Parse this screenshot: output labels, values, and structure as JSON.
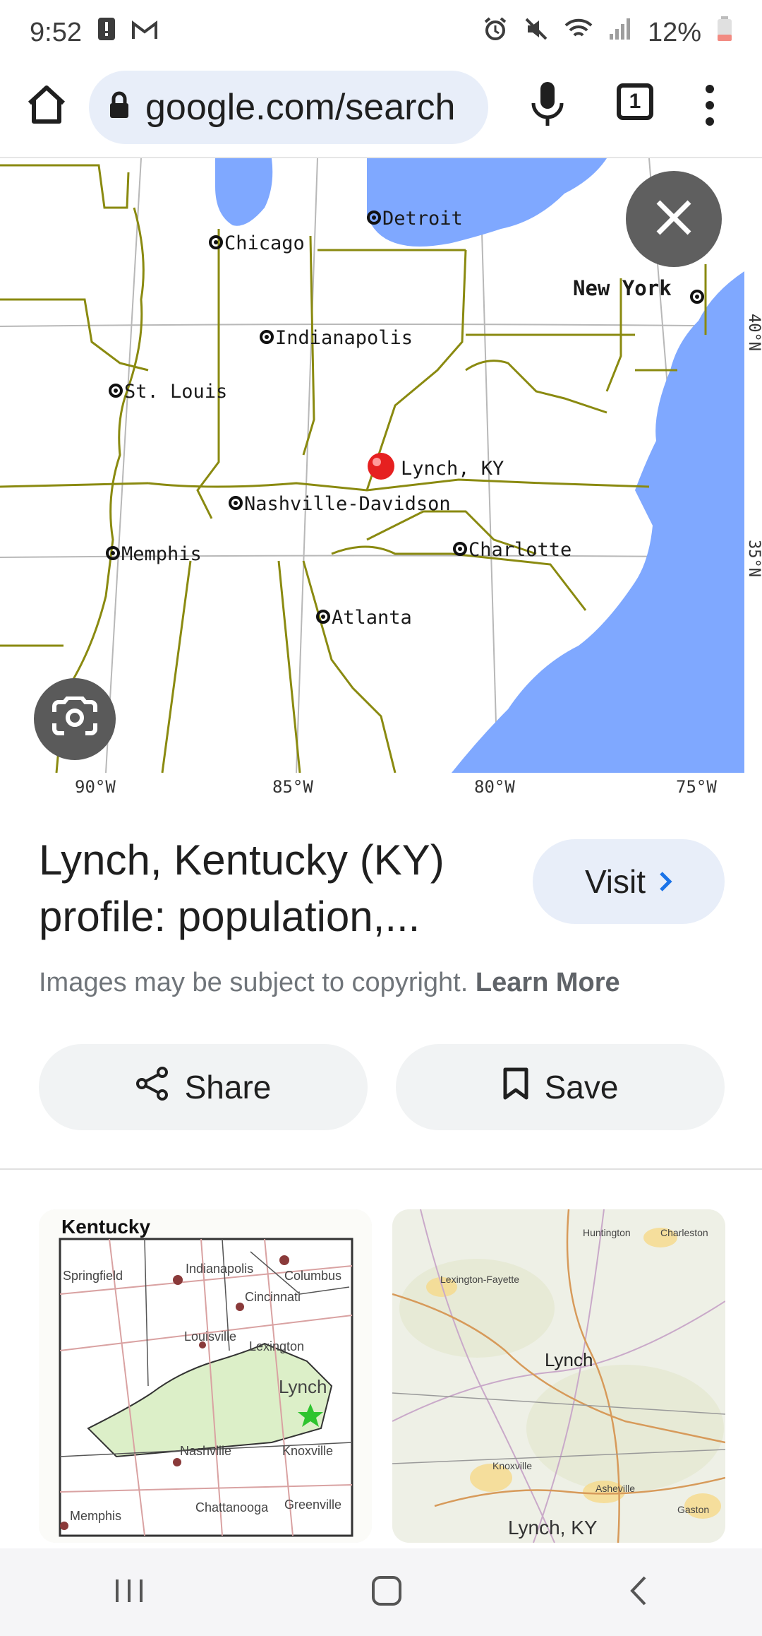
{
  "status": {
    "time": "9:52",
    "battery": "12%"
  },
  "browser": {
    "url": "google.com/search",
    "tab_count": "1"
  },
  "map": {
    "cities": [
      "Detroit",
      "Chicago",
      "New York",
      "Indianapolis",
      "St. Louis",
      "Lynch, KY",
      "Nashville-Davidson",
      "Memphis",
      "Charlotte",
      "Atlanta"
    ],
    "lon_labels": [
      "90°W",
      "85°W",
      "80°W",
      "75°W"
    ],
    "lat_labels": [
      "40°N",
      "35°N"
    ]
  },
  "result": {
    "title": "Lynch, Kentucky (KY) profile: population,...",
    "visit_label": "Visit",
    "copyright_text": "Images may be subject to copyright.",
    "learn_more": "Learn More",
    "share_label": "Share",
    "save_label": "Save"
  },
  "thumb1": {
    "title": "Kentucky",
    "cities": [
      "Springfield",
      "Indianapolis",
      "Columbus",
      "Cincinnati",
      "Louisville",
      "Lexington",
      "Lynch",
      "Nashville",
      "Knoxville",
      "Memphis",
      "Chattanooga",
      "Greenville"
    ]
  },
  "thumb2": {
    "cities": [
      "Huntington",
      "Charleston",
      "Lexington-Fayette",
      "Lynch",
      "Knoxville",
      "Asheville",
      "Gaston"
    ],
    "caption": "Lynch, KY"
  }
}
